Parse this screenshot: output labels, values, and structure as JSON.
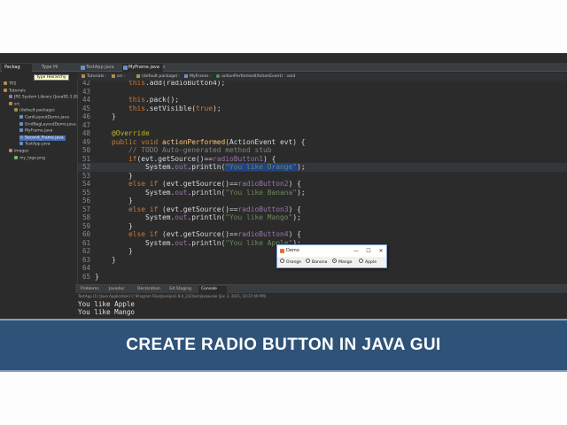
{
  "package_explorer": {
    "tabs": [
      "Packag",
      "Type Hi"
    ],
    "tooltip": "Type Hierarchy",
    "tree": [
      {
        "label": "TP2",
        "indent": 0,
        "color": "#b58a4a"
      },
      {
        "label": "Tutorials",
        "indent": 0,
        "color": "#b58a4a"
      },
      {
        "label": "JRE System Library [JavaSE-1.8]",
        "indent": 1,
        "color": "#8a7ab5"
      },
      {
        "label": "src",
        "indent": 1,
        "color": "#b58a4a"
      },
      {
        "label": "(default package)",
        "indent": 2,
        "color": "#a58a4a"
      },
      {
        "label": "CardLayoutDemo.java",
        "indent": 3,
        "color": "#6b8fc7"
      },
      {
        "label": "GridBagLayoutDemo.java",
        "indent": 3,
        "color": "#6b8fc7"
      },
      {
        "label": "MyFrame.java",
        "indent": 3,
        "color": "#6b8fc7"
      },
      {
        "label": "Second_Frame.java",
        "indent": 3,
        "color": "#6b8fc7",
        "selected": true
      },
      {
        "label": "TestApp.java",
        "indent": 3,
        "color": "#6b8fc7"
      },
      {
        "label": "images",
        "indent": 1,
        "color": "#b58a4a"
      },
      {
        "label": "my_logo.png",
        "indent": 2,
        "color": "#7ab56b"
      }
    ]
  },
  "editor": {
    "tabs": [
      {
        "label": "TestApp.java",
        "active": false
      },
      {
        "label": "MyFrame.java",
        "active": true
      }
    ],
    "breadcrumb": [
      "Tutorials",
      "src",
      "(default package)",
      "MyFrame",
      "actionPerformed(ActionEvent) : void"
    ],
    "lines": [
      {
        "n": "42",
        "segs": [
          {
            "t": "        "
          },
          {
            "t": "this",
            "c": "kw"
          },
          {
            "t": ".add(radioButton4);"
          }
        ]
      },
      {
        "n": "43",
        "segs": [
          {
            "t": ""
          }
        ]
      },
      {
        "n": "44",
        "segs": [
          {
            "t": "        "
          },
          {
            "t": "this",
            "c": "kw"
          },
          {
            "t": ".pack();"
          }
        ]
      },
      {
        "n": "45",
        "segs": [
          {
            "t": "        "
          },
          {
            "t": "this",
            "c": "kw"
          },
          {
            "t": ".setVisible("
          },
          {
            "t": "true",
            "c": "kw"
          },
          {
            "t": ");"
          }
        ]
      },
      {
        "n": "46",
        "segs": [
          {
            "t": "    }"
          }
        ]
      },
      {
        "n": "47",
        "segs": [
          {
            "t": ""
          }
        ]
      },
      {
        "n": "48",
        "segs": [
          {
            "t": "    "
          },
          {
            "t": "@Override",
            "c": "ann"
          }
        ]
      },
      {
        "n": "49",
        "segs": [
          {
            "t": "    "
          },
          {
            "t": "public void ",
            "c": "kw"
          },
          {
            "t": "actionPerformed",
            "c": "mth"
          },
          {
            "t": "(ActionEvent evt) {"
          }
        ]
      },
      {
        "n": "50",
        "segs": [
          {
            "t": "        "
          },
          {
            "t": "// TODO Auto-generated method stub",
            "c": "cmt"
          }
        ]
      },
      {
        "n": "51",
        "segs": [
          {
            "t": "        "
          },
          {
            "t": "if",
            "c": "kw"
          },
          {
            "t": "(evt.getSource()=="
          },
          {
            "t": "radioButton1",
            "c": "fld"
          },
          {
            "t": ") {"
          }
        ]
      },
      {
        "n": "52",
        "segs": [
          {
            "t": "            System."
          },
          {
            "t": "out",
            "c": "fld"
          },
          {
            "t": ".println("
          },
          {
            "t": "\"You like Orange\"",
            "c": "selstr"
          },
          {
            "t": ");"
          }
        ],
        "hl": true
      },
      {
        "n": "53",
        "segs": [
          {
            "t": "        }"
          }
        ]
      },
      {
        "n": "54",
        "segs": [
          {
            "t": "        "
          },
          {
            "t": "else if",
            "c": "kw"
          },
          {
            "t": " (evt.getSource()=="
          },
          {
            "t": "radioButton2",
            "c": "fld"
          },
          {
            "t": ") {"
          }
        ]
      },
      {
        "n": "55",
        "segs": [
          {
            "t": "            System."
          },
          {
            "t": "out",
            "c": "fld"
          },
          {
            "t": ".println("
          },
          {
            "t": "\"You like Banana\"",
            "c": "str"
          },
          {
            "t": ");"
          }
        ]
      },
      {
        "n": "56",
        "segs": [
          {
            "t": "        }"
          }
        ]
      },
      {
        "n": "57",
        "segs": [
          {
            "t": "        "
          },
          {
            "t": "else if",
            "c": "kw"
          },
          {
            "t": " (evt.getSource()=="
          },
          {
            "t": "radioButton3",
            "c": "fld"
          },
          {
            "t": ") {"
          }
        ]
      },
      {
        "n": "58",
        "segs": [
          {
            "t": "            System."
          },
          {
            "t": "out",
            "c": "fld"
          },
          {
            "t": ".println("
          },
          {
            "t": "\"You like Mango\"",
            "c": "str"
          },
          {
            "t": ");"
          }
        ]
      },
      {
        "n": "59",
        "segs": [
          {
            "t": "        }"
          }
        ]
      },
      {
        "n": "60",
        "segs": [
          {
            "t": "        "
          },
          {
            "t": "else if",
            "c": "kw"
          },
          {
            "t": " (evt.getSource()=="
          },
          {
            "t": "radioButton4",
            "c": "fld"
          },
          {
            "t": ") {"
          }
        ]
      },
      {
        "n": "61",
        "segs": [
          {
            "t": "            System."
          },
          {
            "t": "out",
            "c": "fld"
          },
          {
            "t": ".println("
          },
          {
            "t": "\"You like Apple\"",
            "c": "str"
          },
          {
            "t": ");"
          }
        ]
      },
      {
        "n": "62",
        "segs": [
          {
            "t": "        }"
          }
        ]
      },
      {
        "n": "63",
        "segs": [
          {
            "t": "    }"
          }
        ]
      },
      {
        "n": "64",
        "segs": [
          {
            "t": ""
          }
        ]
      },
      {
        "n": "65",
        "segs": [
          {
            "t": "}"
          }
        ]
      }
    ]
  },
  "demo_window": {
    "title": "Demo",
    "minimize": "—",
    "maximize": "☐",
    "close": "✕",
    "radios": [
      {
        "label": "Orange",
        "selected": false
      },
      {
        "label": "Banana",
        "selected": false
      },
      {
        "label": "Mango",
        "selected": true
      },
      {
        "label": "Apple",
        "selected": false
      }
    ]
  },
  "console": {
    "tabs": [
      {
        "label": "Problems",
        "active": false
      },
      {
        "label": "Javadoc",
        "active": false
      },
      {
        "label": "Declaration",
        "active": false
      },
      {
        "label": "Git Staging",
        "active": false
      },
      {
        "label": "Console",
        "active": true
      }
    ],
    "status": "TestApp (1) [Java Application] C:\\Program Files\\Java\\jre1.8.0_231\\bin\\javaw.exe (Jun 3, 2021, 10:17:49 PM)",
    "output": [
      "You like Apple",
      "You like Mango"
    ]
  },
  "banner": {
    "title": "CREATE RADIO BUTTON IN JAVA GUI"
  }
}
